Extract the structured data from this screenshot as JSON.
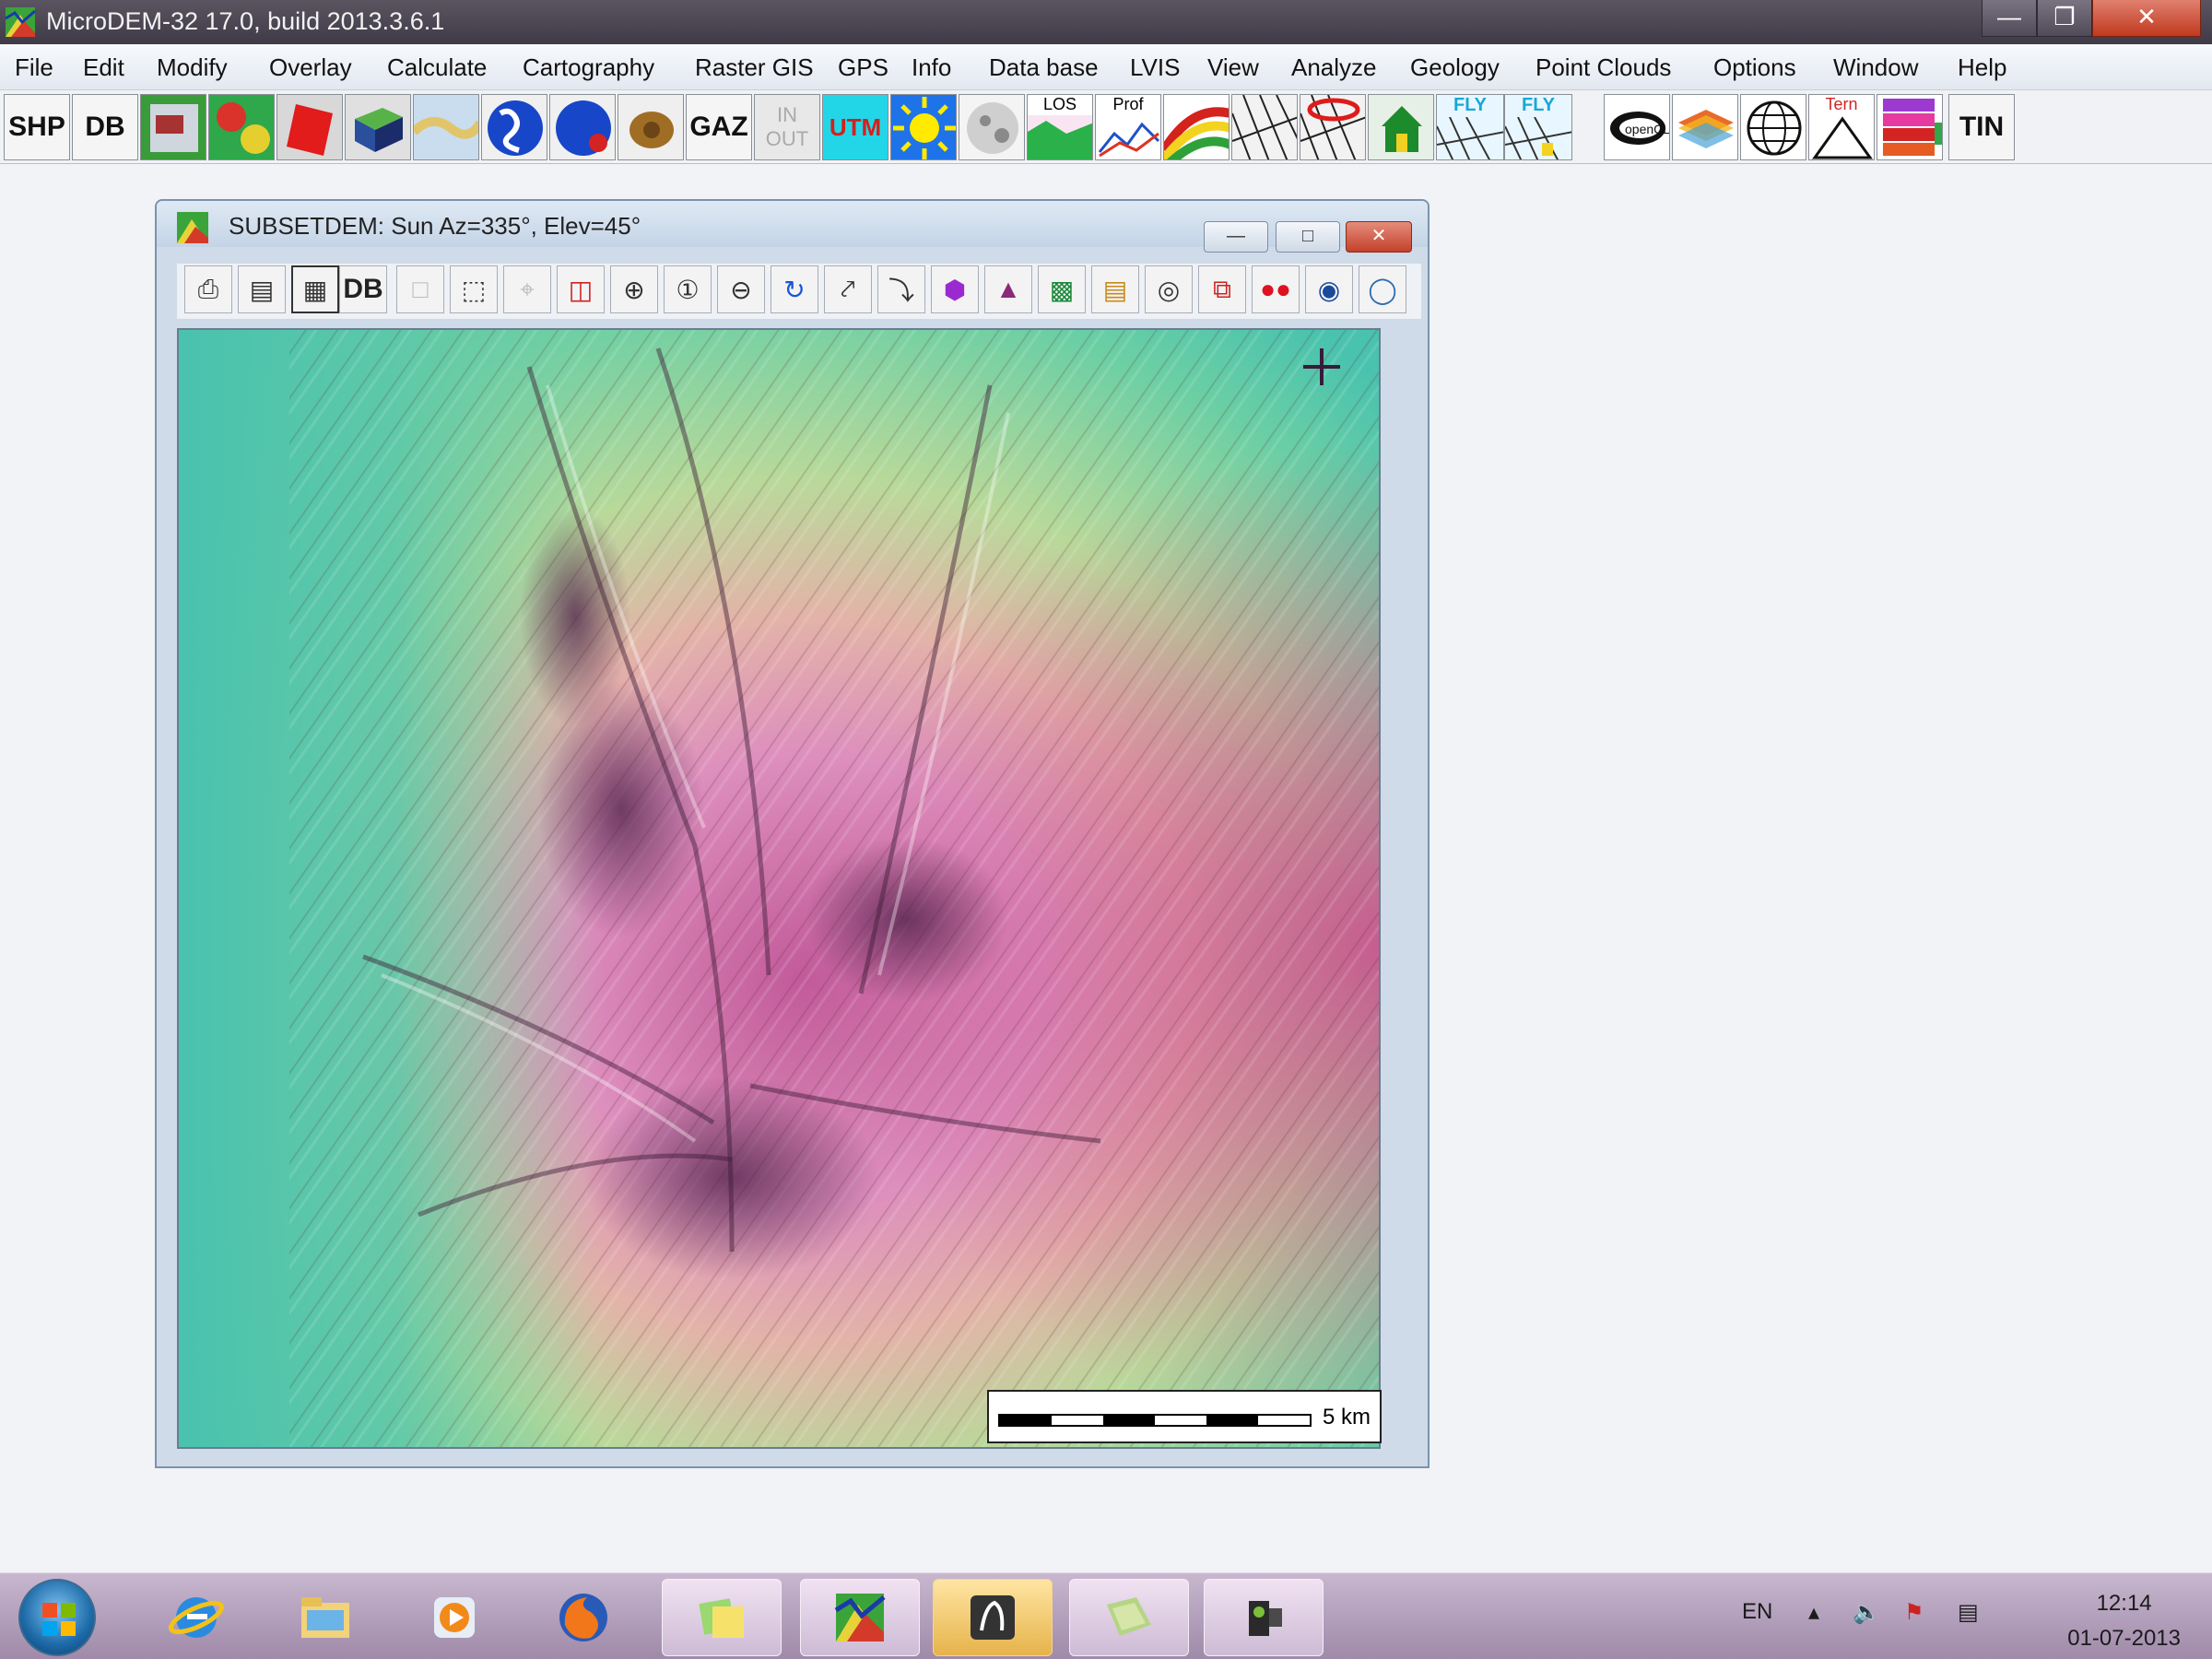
{
  "app": {
    "title": "MicroDEM-32 17.0, build 2013.3.6.1",
    "window_buttons": [
      "minimize-icon",
      "maximize-icon",
      "close-icon"
    ]
  },
  "menu": [
    "File",
    "Edit",
    "Modify",
    "Overlay",
    "Calculate",
    "Cartography",
    "Raster GIS",
    "GPS",
    "Info",
    "Data base",
    "LVIS",
    "View",
    "Analyze",
    "Geology",
    "Point Clouds",
    "Options",
    "Window",
    "Help"
  ],
  "toolbar": {
    "shp_label": "SHP",
    "db_label": "DB",
    "gaz_label": "GAZ",
    "tin_label": "TIN",
    "los_label": "LOS",
    "prof_label": "Prof",
    "tern_label": "Tern",
    "fly_label": "FLY",
    "in_label": "IN",
    "out_label": "OUT",
    "utm_label": "UTM"
  },
  "child_window": {
    "title": "SUBSETDEM: Sun Az=335°, Elev=45°",
    "db_label": "DB",
    "scale_label": "5 km"
  },
  "colors": {
    "low": "#4fc7b0",
    "mid": "#a8d68a",
    "high": "#d98bb4",
    "peak": "#6a2f5e",
    "titlebar": "#4a4452",
    "taskbar": "#b39fbb"
  },
  "taskbar": {
    "lang": "EN",
    "time": "12:14",
    "date": "01-07-2013"
  }
}
